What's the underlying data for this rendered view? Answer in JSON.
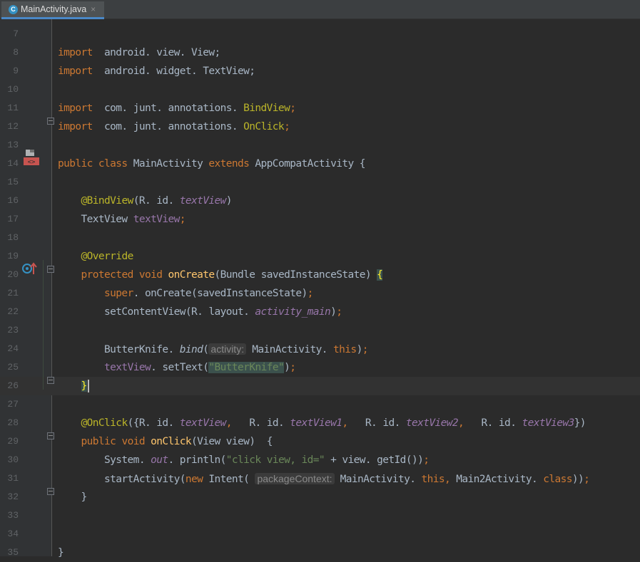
{
  "tab": {
    "icon_letter": "C",
    "filename": "MainActivity.java",
    "close": "×"
  },
  "lines": [
    {
      "n": "7",
      "code": []
    },
    {
      "n": "8",
      "code": [
        [
          "kw",
          "import"
        ],
        [
          "",
          "  android. view. View;"
        ]
      ]
    },
    {
      "n": "9",
      "code": [
        [
          "kw",
          "import"
        ],
        [
          "",
          "  android. widget. TextView;"
        ]
      ]
    },
    {
      "n": "10",
      "code": []
    },
    {
      "n": "11",
      "code": [
        [
          "kw",
          "import"
        ],
        [
          "",
          "  com. junt. annotations. "
        ],
        [
          "an",
          "BindView"
        ],
        [
          "kw",
          ";"
        ]
      ]
    },
    {
      "n": "12",
      "code": [
        [
          "kw",
          "import"
        ],
        [
          "",
          "  com. junt. annotations. "
        ],
        [
          "an",
          "OnClick"
        ],
        [
          "kw",
          ";"
        ]
      ]
    },
    {
      "n": "13",
      "code": []
    },
    {
      "n": "14",
      "code": [
        [
          "kw",
          "public class "
        ],
        [
          "",
          "MainActivity "
        ],
        [
          "kw",
          "extends "
        ],
        [
          "",
          "AppCompatActivity {"
        ]
      ]
    },
    {
      "n": "15",
      "code": []
    },
    {
      "n": "16",
      "code": [
        [
          "",
          "    "
        ],
        [
          "an",
          "@BindView"
        ],
        [
          "",
          "(R. id. "
        ],
        [
          "ifld",
          "textView"
        ],
        [
          "",
          ")"
        ]
      ]
    },
    {
      "n": "17",
      "code": [
        [
          "",
          "    TextView "
        ],
        [
          "fld",
          "textView"
        ],
        [
          "kw",
          ";"
        ]
      ]
    },
    {
      "n": "18",
      "code": []
    },
    {
      "n": "19",
      "code": [
        [
          "",
          "    "
        ],
        [
          "an",
          "@Override"
        ]
      ]
    },
    {
      "n": "20",
      "code": [
        [
          "",
          "    "
        ],
        [
          "kw",
          "protected void "
        ],
        [
          "fn",
          "onCreate"
        ],
        [
          "",
          "(Bundle savedInstanceState) "
        ],
        [
          "brace-hl",
          "{"
        ]
      ]
    },
    {
      "n": "21",
      "code": [
        [
          "",
          "        "
        ],
        [
          "kw",
          "super"
        ],
        [
          "",
          ". onCreate(savedInstanceState)"
        ],
        [
          "kw",
          ";"
        ]
      ]
    },
    {
      "n": "22",
      "code": [
        [
          "",
          "        setContentView(R. layout. "
        ],
        [
          "ifld",
          "activity_main"
        ],
        [
          "",
          ")"
        ],
        [
          "kw",
          ";"
        ]
      ]
    },
    {
      "n": "23",
      "code": []
    },
    {
      "n": "24",
      "code": [
        [
          "",
          "        ButterKnife. "
        ],
        [
          "mcall",
          "bind"
        ],
        [
          "",
          "("
        ],
        [
          "hint",
          "activity:"
        ],
        [
          "",
          " MainActivity. "
        ],
        [
          "kw",
          "this"
        ],
        [
          "",
          ")"
        ],
        [
          "kw",
          ";"
        ]
      ]
    },
    {
      "n": "25",
      "code": [
        [
          "",
          "        "
        ],
        [
          "fld",
          "textView"
        ],
        [
          "",
          ". setText("
        ],
        [
          "strhl",
          "\"ButterKnife\""
        ],
        [
          "",
          ")"
        ],
        [
          "kw",
          ";"
        ]
      ]
    },
    {
      "n": "26",
      "code": [
        [
          "",
          "    "
        ],
        [
          "brace-hl",
          "}"
        ],
        [
          "caret",
          ""
        ]
      ],
      "current": true
    },
    {
      "n": "27",
      "code": []
    },
    {
      "n": "28",
      "code": [
        [
          "",
          "    "
        ],
        [
          "an",
          "@OnClick"
        ],
        [
          "",
          "({R. id. "
        ],
        [
          "ifld",
          "textView"
        ],
        [
          "kw",
          ", "
        ],
        [
          "",
          "  R. id. "
        ],
        [
          "ifld",
          "textView1"
        ],
        [
          "kw",
          ", "
        ],
        [
          "",
          "  R. id. "
        ],
        [
          "ifld",
          "textView2"
        ],
        [
          "kw",
          ", "
        ],
        [
          "",
          "  R. id. "
        ],
        [
          "ifld",
          "textView3"
        ],
        [
          "",
          "})"
        ]
      ]
    },
    {
      "n": "29",
      "code": [
        [
          "",
          "    "
        ],
        [
          "kw",
          "public void "
        ],
        [
          "fn",
          "onClick"
        ],
        [
          "",
          "(View view)  {"
        ]
      ]
    },
    {
      "n": "30",
      "code": [
        [
          "",
          "        System. "
        ],
        [
          "ifld",
          "out"
        ],
        [
          "",
          ". println("
        ],
        [
          "str",
          "\"click view, id=\""
        ],
        [
          "",
          " + view. getId())"
        ],
        [
          "kw",
          ";"
        ]
      ]
    },
    {
      "n": "31",
      "code": [
        [
          "",
          "        startActivity("
        ],
        [
          "kw",
          "new "
        ],
        [
          "",
          "Intent( "
        ],
        [
          "hint",
          "packageContext:"
        ],
        [
          "",
          " MainActivity. "
        ],
        [
          "kw",
          "this"
        ],
        [
          "kw",
          ", "
        ],
        [
          "",
          "Main2Activity. "
        ],
        [
          "kw",
          "class"
        ],
        [
          "",
          "))"
        ],
        [
          "kw",
          ";"
        ]
      ]
    },
    {
      "n": "32",
      "code": [
        [
          "",
          "    }"
        ]
      ]
    },
    {
      "n": "33",
      "code": []
    },
    {
      "n": "34",
      "code": []
    },
    {
      "n": "35",
      "code": [
        [
          "",
          "}"
        ]
      ]
    }
  ],
  "gutter_icons": {
    "line14": "layout-file-icon",
    "line20": "override-method-icon"
  },
  "colors": {
    "background": "#2b2b2b",
    "gutter": "#313335",
    "keyword": "#cc7832",
    "annotation": "#bbb529",
    "field": "#9876aa",
    "string": "#6a8759",
    "method": "#ffc66d",
    "text": "#a9b7c6"
  }
}
